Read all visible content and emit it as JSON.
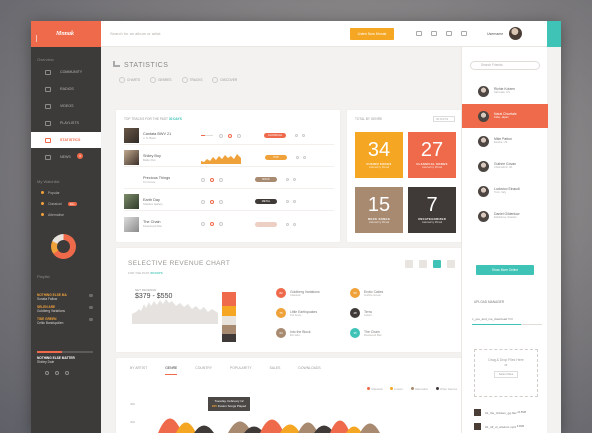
{
  "app": {
    "brand": "Mnnak"
  },
  "topbar": {
    "search_placeholder": "Search for an album or artist",
    "listen_label": "Listen Now Mnnak",
    "user_name": "Username"
  },
  "sidebar": {
    "overview_title": "Overview",
    "nav": [
      {
        "label": "COMMUNITY"
      },
      {
        "label": "RADIOS"
      },
      {
        "label": "VIDEOS"
      },
      {
        "label": "PLAYLISTS"
      },
      {
        "label": "STATISTICS"
      },
      {
        "label": "NEWS",
        "badge": "3"
      }
    ],
    "watchlist_title": "My Watchlist",
    "watchlist": [
      {
        "label": "Popular"
      },
      {
        "label": "Classical",
        "badge": "10+"
      },
      {
        "label": "Alternative"
      }
    ],
    "playlist_title": "Playlist",
    "playlist": [
      {
        "title": "NOTHING ELSE MA",
        "artist": "Sonata Fallow"
      },
      {
        "title": "SELEN ARE",
        "artist": "Goldberg Variations"
      },
      {
        "title": "TIDE GREEN",
        "artist": "Celtic Bandspollen"
      }
    ],
    "now_playing": "NOTHING ELSE MATTER",
    "now_playing_artist": "Shirley Dale"
  },
  "main": {
    "title": "STATISTICS",
    "filters": [
      "CHARTS",
      "GENRES",
      "TRACKS",
      "DISCOVER"
    ],
    "top_tracks": {
      "label": "TOP TRACKS FOR THE PAST",
      "period": "30 DAYS",
      "rows": [
        {
          "name": "Cantata BWV 21",
          "artist": "J. S. Bach",
          "genre": "CLASSICAL",
          "color": "#ee6a4a"
        },
        {
          "name": "Shiley Boy",
          "artist": "Bellie Pan",
          "genre": "POP",
          "color": "#f0a23a"
        },
        {
          "name": "Precious Things",
          "artist": "Tori Amos",
          "genre": "ROCK",
          "color": "#a88a70"
        },
        {
          "name": "Earth Day",
          "artist": "Shadow Gallery",
          "genre": "METAL",
          "color": "#3f3a37"
        },
        {
          "name": "The Chain",
          "artist": "Fleetwood Mac",
          "genre": "",
          "color": "#eecfc4"
        }
      ]
    },
    "genres": {
      "label": "TOTAL BY GENRE",
      "select": "30 DAYS",
      "tiles": [
        {
          "num": "34",
          "label": "FUSION SONGS",
          "sub": "Listened by Mnnak",
          "color": "#f5a623"
        },
        {
          "num": "27",
          "label": "CLASSICAL SONGS",
          "sub": "Listened by Mnnak",
          "color": "#ee6a4a"
        },
        {
          "num": "15",
          "label": "ROCK SONGS",
          "sub": "Listened by Mnnak",
          "color": "#a88a70"
        },
        {
          "num": "7",
          "label": "UNCATEGORIZED",
          "sub": "Listened by Mnnak",
          "color": "#3f3a37"
        }
      ]
    },
    "revenue": {
      "title": "SELECTIVE REVENUE CHART",
      "sub_prefix": "FOR THE PAST",
      "sub_period": "30 DAYS",
      "net_label": "NET REVENUE",
      "net_value": "$379 - $550",
      "items": [
        {
          "num": "82",
          "name": "Goldberg Variations",
          "sub": "Classical",
          "color": "#ee6a4a"
        },
        {
          "num": "75",
          "name": "Little Earthquakes",
          "sub": "Tori Amos",
          "color": "#f0a23a"
        },
        {
          "num": "64",
          "name": "Into the Block",
          "sub": "Eric Elim",
          "color": "#a88a70"
        },
        {
          "num": "59",
          "name": "Erotic Cakes",
          "sub": "Guthrie Govan",
          "color": "#f0a23a"
        },
        {
          "num": "48",
          "name": "Terra",
          "sub": "Lazaro",
          "color": "#3f3a37"
        },
        {
          "num": "35",
          "name": "The Chain",
          "sub": "Fleetwood Mac",
          "color": "#3ec3b6"
        }
      ]
    },
    "tabs": {
      "items": [
        "BY ARTIST",
        "GENRE",
        "COUNTRY",
        "POPULARITY",
        "SALES",
        "DOWNLOADS"
      ],
      "active": 1,
      "legend": [
        "Classical",
        "Fusion",
        "Alternative",
        "Other Genres"
      ],
      "y_ticks": [
        "400",
        "300"
      ],
      "tooltip_date": "Tuesday, February 12",
      "tooltip_value": "225",
      "tooltip_text": "Fusion Songs Played"
    }
  },
  "right": {
    "search_placeholder": "Search Friends",
    "contacts": [
      {
        "name": "Richie Kotzen",
        "loc": "Salt Lake, US"
      },
      {
        "name": "Narai Chuetale",
        "loc": "Kobe, Japan",
        "active": true
      },
      {
        "name": "Mike Patton",
        "loc": "Eureka, US"
      },
      {
        "name": "Guthrie Govan",
        "loc": "Chelmsford, UK"
      },
      {
        "name": "Ludovico Einaudi",
        "loc": "Turin, Italy"
      },
      {
        "name": "Daniel Gildenlow",
        "loc": "Eskilstuna, Sweden"
      }
    ],
    "online_button": "Show More Online",
    "upload_title": "UPLOAD MANAGER",
    "uploads": [
      {
        "name": "c_you_and_me_download",
        "size": "5MB"
      }
    ],
    "drop_text": "Drag & Drop Files Here",
    "drop_or": "or",
    "select_files": "Select Files",
    "finished": [
      {
        "name": "01_the_chicken_gg.flac",
        "size": "24.5MB"
      },
      {
        "name": "02_off_of_wisdom.mp3",
        "size": "8.3MB"
      }
    ]
  }
}
